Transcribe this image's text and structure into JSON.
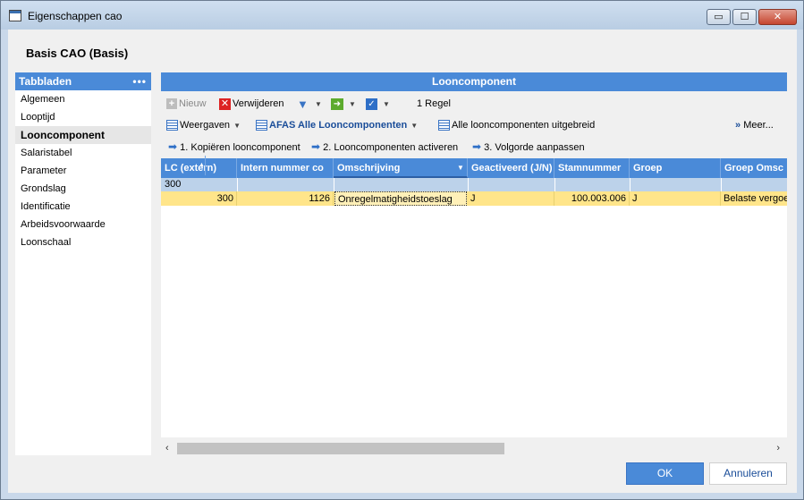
{
  "window": {
    "title": "Eigenschappen cao",
    "min_label": "▭",
    "max_label": "☐",
    "close_label": "✕"
  },
  "cao_title": "Basis CAO (Basis)",
  "sidebar": {
    "header": "Tabbladen",
    "dots": "•••",
    "items": [
      {
        "label": "Algemeen"
      },
      {
        "label": "Looptijd"
      },
      {
        "label": "Looncomponent"
      },
      {
        "label": "Salaristabel"
      },
      {
        "label": "Parameter"
      },
      {
        "label": "Grondslag"
      },
      {
        "label": "Identificatie"
      },
      {
        "label": "Arbeidsvoorwaarde"
      },
      {
        "label": "Loonschaal"
      }
    ]
  },
  "panel": {
    "header": "Looncomponent",
    "toolbar1": {
      "new_label": "Nieuw",
      "delete_label": "Verwijderen",
      "record_count": "1 Regel"
    },
    "toolbar2": {
      "views_label": "Weergaven",
      "view_name": "AFAS Alle Looncomponenten",
      "extended_label": "Alle looncomponenten uitgebreid",
      "more_label": "Meer..."
    },
    "toolbar3": {
      "step1": "1. Kopiëren looncomponent",
      "step2": "2. Looncomponenten activeren",
      "step3": "3. Volgorde aanpassen"
    }
  },
  "grid": {
    "columns": [
      "LC (extern)",
      "Intern nummer co",
      "Omschrijving",
      "Geactiveerd (J/N)",
      "Stamnummer",
      "Groep",
      "Groep Omsc"
    ],
    "group_value": "300",
    "rows": [
      {
        "lc_extern": "300",
        "intern_nummer": "1126",
        "omschrijving": "Onregelmatigheidstoeslag",
        "geactiveerd": "J",
        "stamnummer": "100.003.006",
        "groep": "J",
        "groep_omschrijving": "Belaste vergoe"
      }
    ]
  },
  "buttons": {
    "ok_label": "OK",
    "cancel_label": "Annuleren"
  },
  "colors": {
    "accent": "#4a8ad8",
    "selected_row": "#ffe58a"
  }
}
